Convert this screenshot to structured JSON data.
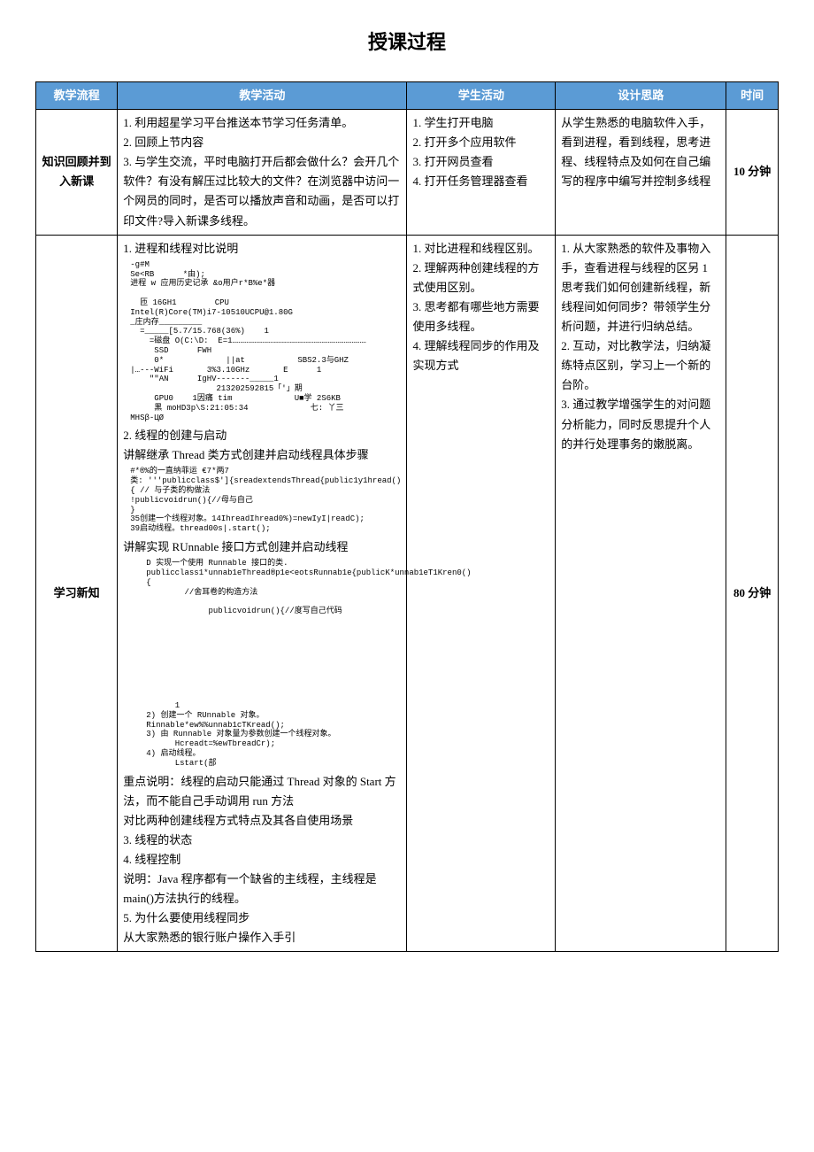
{
  "title": "授课过程",
  "headers": {
    "flow": "教学流程",
    "teach": "教学活动",
    "student": "学生活动",
    "design": "设计思路",
    "time": "时间"
  },
  "row1": {
    "flow": "知识回顾并到入新课",
    "teach_l1": "1. 利用超星学习平台推送本节学习任务清单。",
    "teach_l2": "2. 回顾上节内容",
    "teach_l3": "3. 与学生交流，平时电脑打开后都会做什么？会开几个软件？有没有解压过比较大的文件？在浏览器中访问一个网员的同时，是否可以播放声音和动画，是否可以打印文件?导入新课多线程。",
    "student_l1": "1. 学生打开电脑",
    "student_l2": "2. 打开多个应用软件",
    "student_l3": "3. 打开网员查看",
    "student_l4": "4. 打开任务管理器查看",
    "design": "从学生熟悉的电脑软件入手，看到进程，看到线程，思考进程、线程特点及如何在自己编写的程序中编写并控制多线程",
    "time": "10 分钟"
  },
  "row2": {
    "flow": "学习新知",
    "teach_h1": "1. 进程和线程对比说明",
    "code1": "-g#M\nSe<RB      *由);\n进程 w 应用历史记承 &o用户r*B%e*器\n\n  匝 16GH1        CPU                  Intel(R)Core(TM)i7-10510UCPU@1.80G\n_庄内存_________\n  =_____[5.7/15.768(36%)    1\n    =磁盘 O(C:\\D:  E=1…………………………………………………………………………\n     SSD      FWH\n     0*             ||at           SBS2.3与GHZ\n|…---WiFi       3%3.10GHz       E      1\n    \"\"AN      IgHV-------_____1\n                  213202592815「'」期\n     GPU0    1因痛 tim             U■学 2S6KB\n     黑 moHD3p\\S:21:05:34             七: 丫三\nMHSβ-ЦØ",
    "teach_h2": "2. 线程的创建与启动",
    "teach_h2a": "讲解继承 Thread 类方式创建并启动线程具体步骤",
    "code2": "#*®%的一直纳菲运 €7*两7\n类: '''publicclass$']{sreadextendsThread{public1y1hread(){ // 与子类的构做法\n!publicvoidrun(){//母与自己\n}\n35创建一个线程对象。14IhreadIhread0%)=newIyI|readC);\n39启动线程。thread00s|.start();",
    "teach_h2b": "讲解实现 RUnnable 接口方式创建并启动线程",
    "code3": "D 实现一个使用 Runnable 接口的类.\npublicclass1*unnab1eThread®p1e<eotsRunnab1e{publicK*unnab1eT1Kren0(){\n        //舍耳卷的构造方法\n\n             publicvoidrun(){//度写自己代码",
    "code4": "      1\n2) 创建一个 RUnnable 对象。Rinnable*ew%%unnab1cTKread();\n3) 由 Runnable 对象量为参数创建一个线程对象。\n      Hcreadt=%ewTbreadCr);\n4) 启动线程。\n      Lstart(部",
    "teach_h2c": "重点说明：线程的启动只能通过 Thread 对象的 Start 方法，而不能自己手动调用 run 方法",
    "teach_h2d": "对比两种创建线程方式特点及其各自使用场景",
    "teach_h3": "3. 线程的状态",
    "teach_h4": "4. 线程控制",
    "teach_h4a": "说明：Java 程序都有一个缺省的主线程，主线程是 main()方法执行的线程。",
    "teach_h5": "5. 为什么要使用线程同步",
    "teach_h5a": "从大家熟悉的银行账户操作入手引",
    "student_l1": "1. 对比进程和线程区别。",
    "student_l2": "2. 理解两种创建线程的方式使用区别。",
    "student_l3": "3. 思考都有哪些地方需要使用多线程。",
    "student_l4": "4. 理解线程同步的作用及实现方式",
    "design_l1": "1. 从大家熟悉的软件及事物入手，查看进程与线程的区另 1 思考我们如何创建新线程，新线程间如何同步？带领学生分析问题，并进行归纳总结。",
    "design_l2": "2. 互动，对比教学法，归纳凝练特点区别，学习上一个新的台阶。",
    "design_l3": "3. 通过教学增强学生的对问题分析能力，同时反思提升个人的并行处理事务的嫩脱离。",
    "time": "80 分钟"
  }
}
